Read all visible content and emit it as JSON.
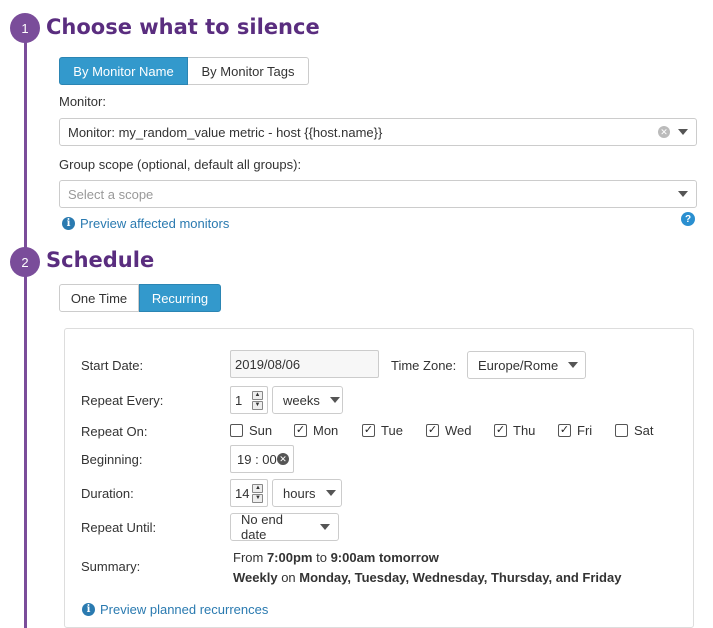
{
  "section1": {
    "step_number": "1",
    "title": "Choose what to silence",
    "tabs": [
      "By Monitor Name",
      "By Monitor Tags"
    ],
    "monitor_label": "Monitor:",
    "monitor_value": "Monitor: my_random_value metric - host {{host.name}}",
    "group_scope_label": "Group scope (optional, default all groups):",
    "group_scope_placeholder": "Select a scope",
    "preview_link": "Preview affected monitors"
  },
  "section2": {
    "step_number": "2",
    "title": "Schedule",
    "tabs": [
      "One Time",
      "Recurring"
    ],
    "start_date_label": "Start Date:",
    "start_date_value": "2019/08/06",
    "time_zone_label": "Time Zone:",
    "time_zone_value": "Europe/Rome",
    "repeat_every_label": "Repeat Every:",
    "repeat_every_value": "1",
    "repeat_every_unit": "weeks",
    "repeat_on_label": "Repeat On:",
    "days": [
      {
        "label": "Sun",
        "checked": false
      },
      {
        "label": "Mon",
        "checked": true
      },
      {
        "label": "Tue",
        "checked": true
      },
      {
        "label": "Wed",
        "checked": true
      },
      {
        "label": "Thu",
        "checked": true
      },
      {
        "label": "Fri",
        "checked": true
      },
      {
        "label": "Sat",
        "checked": false
      }
    ],
    "beginning_label": "Beginning:",
    "beginning_value": "19 : 00",
    "duration_label": "Duration:",
    "duration_value": "14",
    "duration_unit": "hours",
    "repeat_until_label": "Repeat Until:",
    "repeat_until_value": "No end date",
    "summary_label": "Summary:",
    "summary_line1": {
      "from": "From ",
      "start": "7:00pm",
      "to": " to ",
      "end": "9:00am tomorrow"
    },
    "summary_line2": {
      "freq": "Weekly",
      "on": " on ",
      "days": "Monday, Tuesday, Wednesday, Thursday, and Friday"
    },
    "preview_link": "Preview planned recurrences"
  },
  "colors": {
    "accent_purple": "#7a4d9a",
    "active_blue": "#3399cc",
    "link_blue": "#2a7ab0"
  }
}
